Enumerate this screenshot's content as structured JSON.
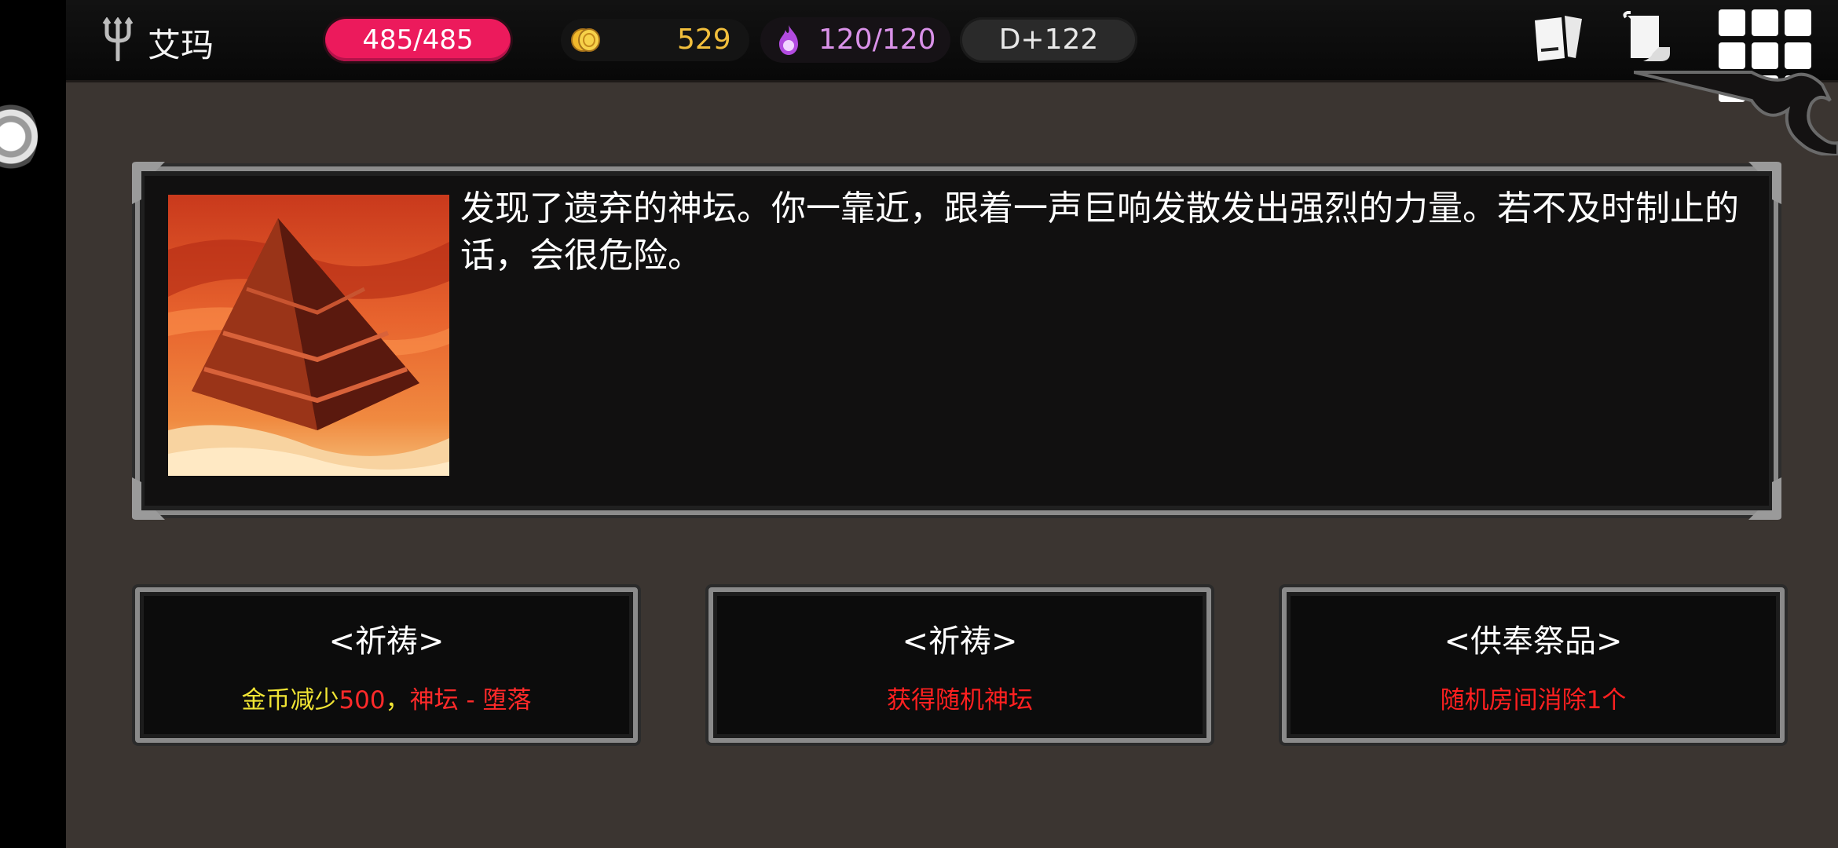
{
  "player": {
    "name": "艾玛",
    "hp": "485/485",
    "gold": "529",
    "soul": "120/120",
    "day": "D+122"
  },
  "icons": {
    "trident": "trident-icon",
    "coin": "gold-coin-icon",
    "soul": "purple-soul-flame-icon",
    "cards": "card-deck-icon",
    "map": "scroll-map-icon",
    "menu": "grid-menu-icon"
  },
  "event": {
    "description": "发现了遗弃的神坛。你一靠近，跟着一声巨响发散发出强烈的力量。若不及时制止的话，会很危险。",
    "image": "pyramid-altar-illustration"
  },
  "choices": [
    {
      "title": "<祈祷>",
      "effect_parts": [
        "金币减少",
        "500",
        "，",
        "神坛 - 堕落"
      ]
    },
    {
      "title": "<祈祷>",
      "effect": "获得随机神坛"
    },
    {
      "title": "<供奉祭品>",
      "effect": "随机房间消除1个"
    }
  ],
  "colors": {
    "hp": "#ec1a5c",
    "gold_text": "#f2bf3c",
    "soul_text": "#d991e8",
    "effect_red": "#ff2a2a",
    "effect_yellow": "#f1e534",
    "background": "#3b3531"
  }
}
